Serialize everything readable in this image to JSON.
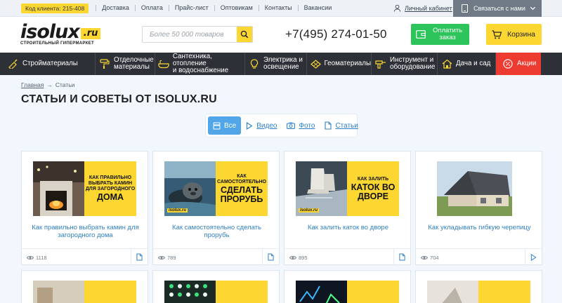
{
  "topbar": {
    "client_code": "Код клиента: 215-408",
    "links": [
      "Доставка",
      "Оплата",
      "Прайс-лист",
      "Оптовикам",
      "Контакты",
      "Вакансии"
    ],
    "cabinet": "Личный кабинет",
    "callback": "Связаться с нами"
  },
  "header": {
    "logo_word": "isolux",
    "logo_ru": ".ru",
    "logo_sub": "СТРОИТЕЛЬНЫЙ ГИПЕРМАРКЕТ",
    "search_placeholder": "Более 50 000 товаров",
    "phone": "+7(495) 274-01-50",
    "pay_label": "Оплатить заказ",
    "cart_label": "Корзина"
  },
  "categories": [
    {
      "label": "Стройматериалы",
      "icon": "trowel-icon"
    },
    {
      "label": "Отделочные\nматериалы",
      "icon": "paint-roller-icon"
    },
    {
      "label": "Сантехника, отопление\nи водоснабжение",
      "icon": "bathtub-icon"
    },
    {
      "label": "Электрика и\nосвещение",
      "icon": "lightbulb-icon"
    },
    {
      "label": "Геоматериалы",
      "icon": "geogrid-icon"
    },
    {
      "label": "Инструмент и\nоборудование",
      "icon": "drill-icon"
    },
    {
      "label": "Дача и сад",
      "icon": "house-icon"
    },
    {
      "label": "Акции",
      "icon": "percent-icon"
    }
  ],
  "breadcrumb": {
    "home": "Главная",
    "separator": "→",
    "current": "Статьи"
  },
  "page_title": "СТАТЬИ И СОВЕТЫ ОТ ISOLUX.RU",
  "filters": [
    {
      "label": "Все",
      "icon": "all-icon",
      "active": true
    },
    {
      "label": "Видео",
      "icon": "play-icon",
      "active": false
    },
    {
      "label": "Фото",
      "icon": "camera-icon",
      "active": false
    },
    {
      "label": "Статьи",
      "icon": "document-icon",
      "active": false
    }
  ],
  "articles": [
    {
      "title": "Как правильно выбрать камин для загородного дома",
      "views": "1118",
      "type_icon": "document-icon",
      "promo_small": "КАК ПРАВИЛЬНО ВЫБРАТЬ КАМИН ДЛЯ ЗАГОРОДНОГО",
      "promo_big": "ДОМА"
    },
    {
      "title": "Как самостоятельно сделать прорубь",
      "views": "789",
      "type_icon": "document-icon",
      "promo_small": "КАК САМОСТОЯТЕЛЬНО",
      "promo_big": "СДЕЛАТЬ ПРОРУБЬ"
    },
    {
      "title": "Как залить каток во дворе",
      "views": "895",
      "type_icon": "document-icon",
      "promo_small": "КАК ЗАЛИТЬ",
      "promo_big": "КАТОК ВО ДВОРЕ"
    },
    {
      "title": "Как укладывать гибкую черепицу",
      "views": "704",
      "type_icon": "play-icon",
      "promo_small": "",
      "promo_big": ""
    }
  ],
  "colors": {
    "brand_yellow": "#fcd731",
    "nav_dark": "#2d3036",
    "sale_red": "#ee3b31",
    "pay_green": "#2dc45b",
    "link_blue": "#2f80c7"
  }
}
